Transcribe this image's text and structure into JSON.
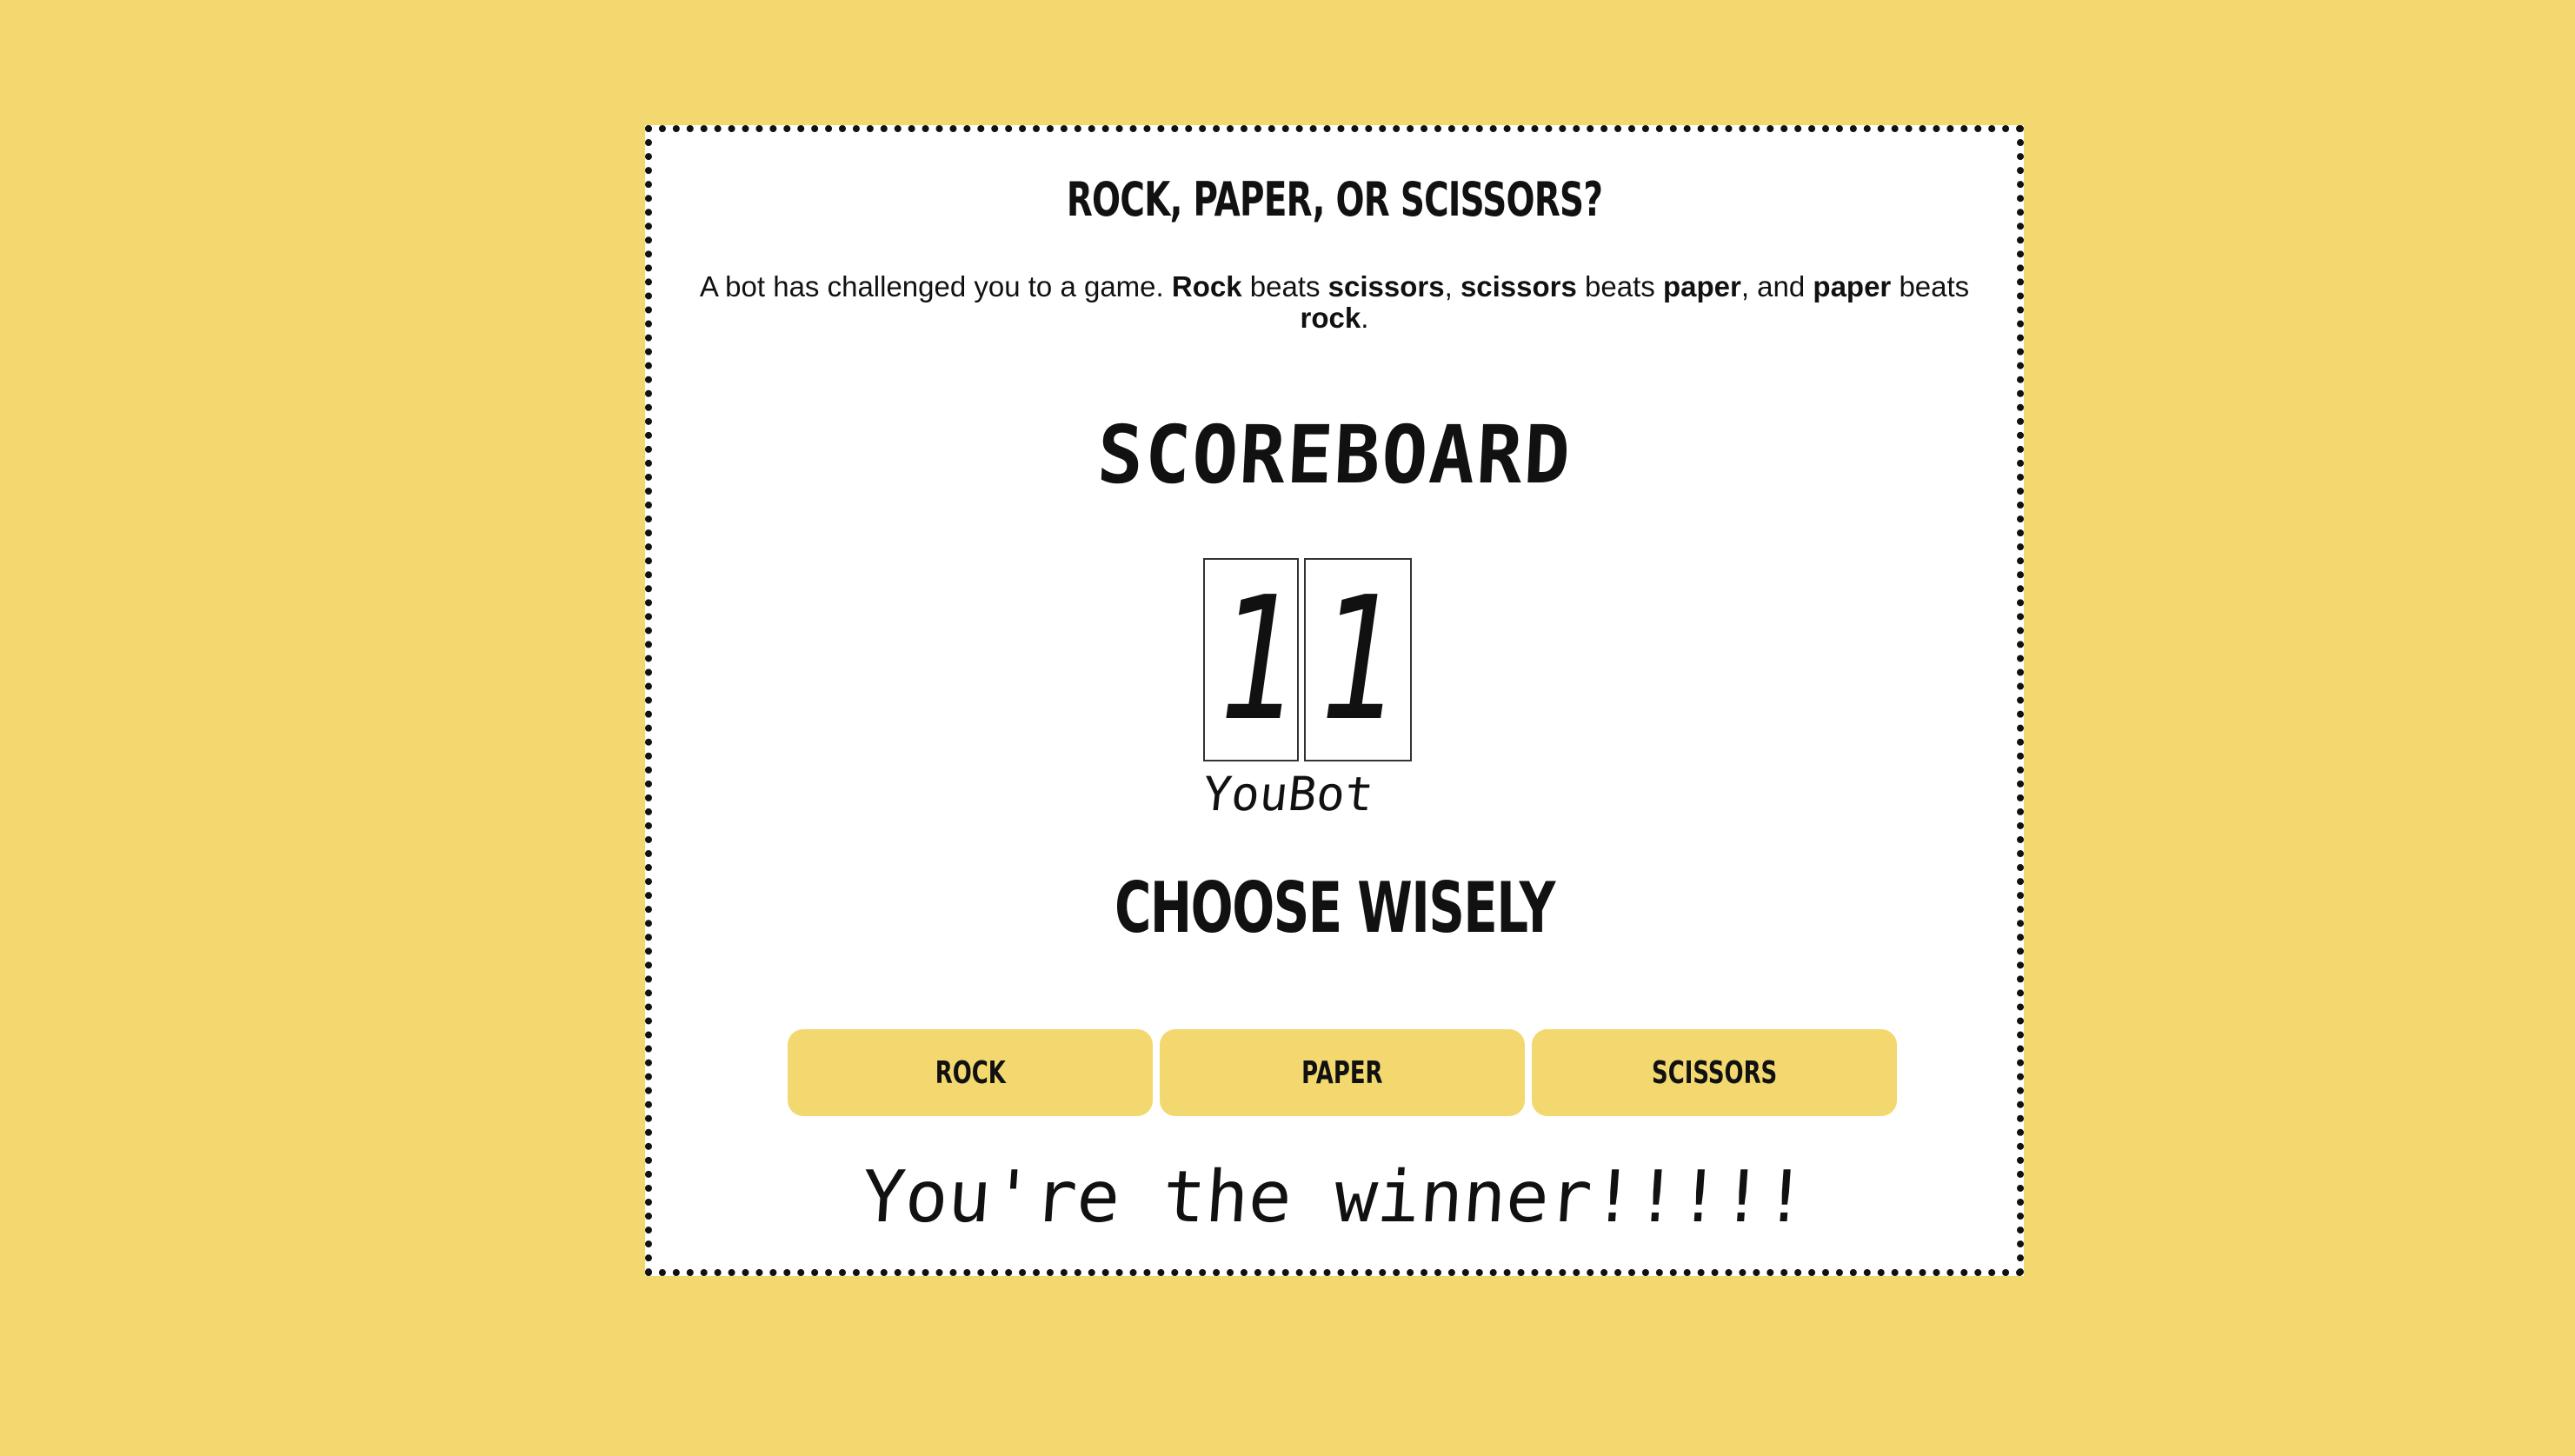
{
  "colors": {
    "background": "#f3d86f",
    "card": "#ffffff",
    "button": "#f3d86f",
    "text": "#111111"
  },
  "game": {
    "title": "ROCK, PAPER, OR SCISSORS?",
    "intro": {
      "p1": "A bot has challenged you to a game. ",
      "rock": "Rock",
      "p2": " beats ",
      "scissors": "scissors",
      "p3": ", ",
      "scissors2": "scissors",
      "p4": " beats ",
      "paper": "paper",
      "p5": ", and ",
      "paper2": "paper",
      "p6": " beats ",
      "rock2": "rock",
      "p7": "."
    },
    "scoreboard_title": "SCOREBOARD",
    "score": {
      "you": "1",
      "bot": "1",
      "you_label": "You",
      "bot_label": "Bot"
    },
    "choose_title": "CHOOSE WISELY",
    "buttons": {
      "rock": "ROCK",
      "paper": "PAPER",
      "scissors": "SCISSORS"
    },
    "result": "You're the winner!!!!!"
  }
}
